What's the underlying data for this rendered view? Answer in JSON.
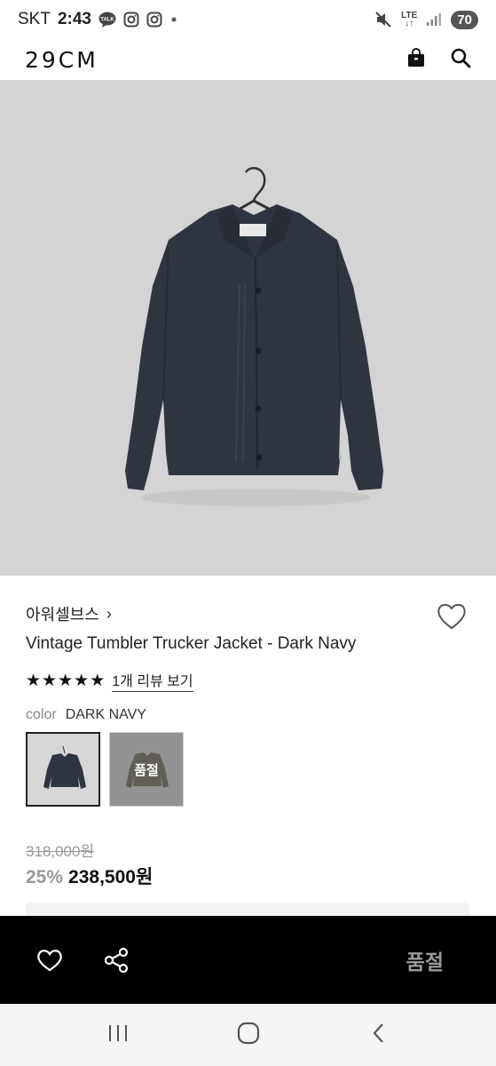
{
  "status_bar": {
    "carrier": "SKT",
    "time": "2:43",
    "network": "LTE",
    "battery": "70",
    "icons": [
      "talk-icon",
      "instagram-icon",
      "instagram-icon",
      "dot-icon",
      "mute-icon",
      "signal-icon"
    ]
  },
  "header": {
    "logo": "29CM",
    "icons": [
      "shopping-bag-icon",
      "search-icon"
    ]
  },
  "product": {
    "brand": "아워셀브스",
    "title": "Vintage Tumbler Trucker Jacket - Dark Navy",
    "rating_stars": 5,
    "review_link": "1개 리뷰 보기",
    "color_label": "color",
    "color_value": "DARK NAVY",
    "options": [
      {
        "name": "dark-navy",
        "selected": true,
        "soldout": false
      },
      {
        "name": "khaki",
        "selected": false,
        "soldout": true,
        "label": "품절"
      }
    ],
    "original_price": "318,000원",
    "discount": "25%",
    "price": "238,500원"
  },
  "action_bar": {
    "soldout_label": "품절",
    "icons": [
      "heart-icon",
      "share-icon"
    ]
  },
  "colors": {
    "hero_bg": "#d4d4d4",
    "jacket": "#2f3540",
    "action_bar": "#000000",
    "soldout_text": "#9a9a9a"
  }
}
